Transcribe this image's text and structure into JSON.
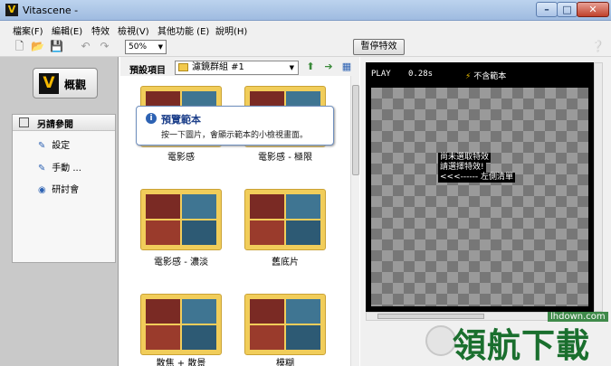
{
  "window": {
    "title": "Vitascene -"
  },
  "menu": [
    "檔案(F)",
    "編輯(E)",
    "特效",
    "檢視(V)",
    "其他功能 (E)",
    "說明(H)"
  ],
  "toolbar": {
    "zoom": "50%",
    "pause_label": "暫停特效"
  },
  "left": {
    "overview_label": "概觀",
    "ref_title": "另請參閱",
    "items": [
      "設定",
      "手動 ...",
      "研討會"
    ]
  },
  "preset": {
    "label": "預設項目",
    "group": "濾鏡群組 #1",
    "thumbs": [
      {
        "label": "電影感"
      },
      {
        "label": "電影感 - 極限"
      },
      {
        "label": "電影感 - 濃淡"
      },
      {
        "label": "舊底片"
      },
      {
        "label": "散焦 + 散景"
      },
      {
        "label": "模糊"
      }
    ]
  },
  "tooltip": {
    "title": "預覽範本",
    "text": "按一下圖片，會顯示範本的小檢視畫面。"
  },
  "preview": {
    "play": "PLAY",
    "time": "0.28s",
    "no_sample": "不含範本",
    "messages": [
      "尚未選取特效",
      "請選擇特效!",
      "<<<------ 左側清單"
    ]
  },
  "watermark": {
    "text": "領航下載",
    "url": "lhdown.com"
  }
}
